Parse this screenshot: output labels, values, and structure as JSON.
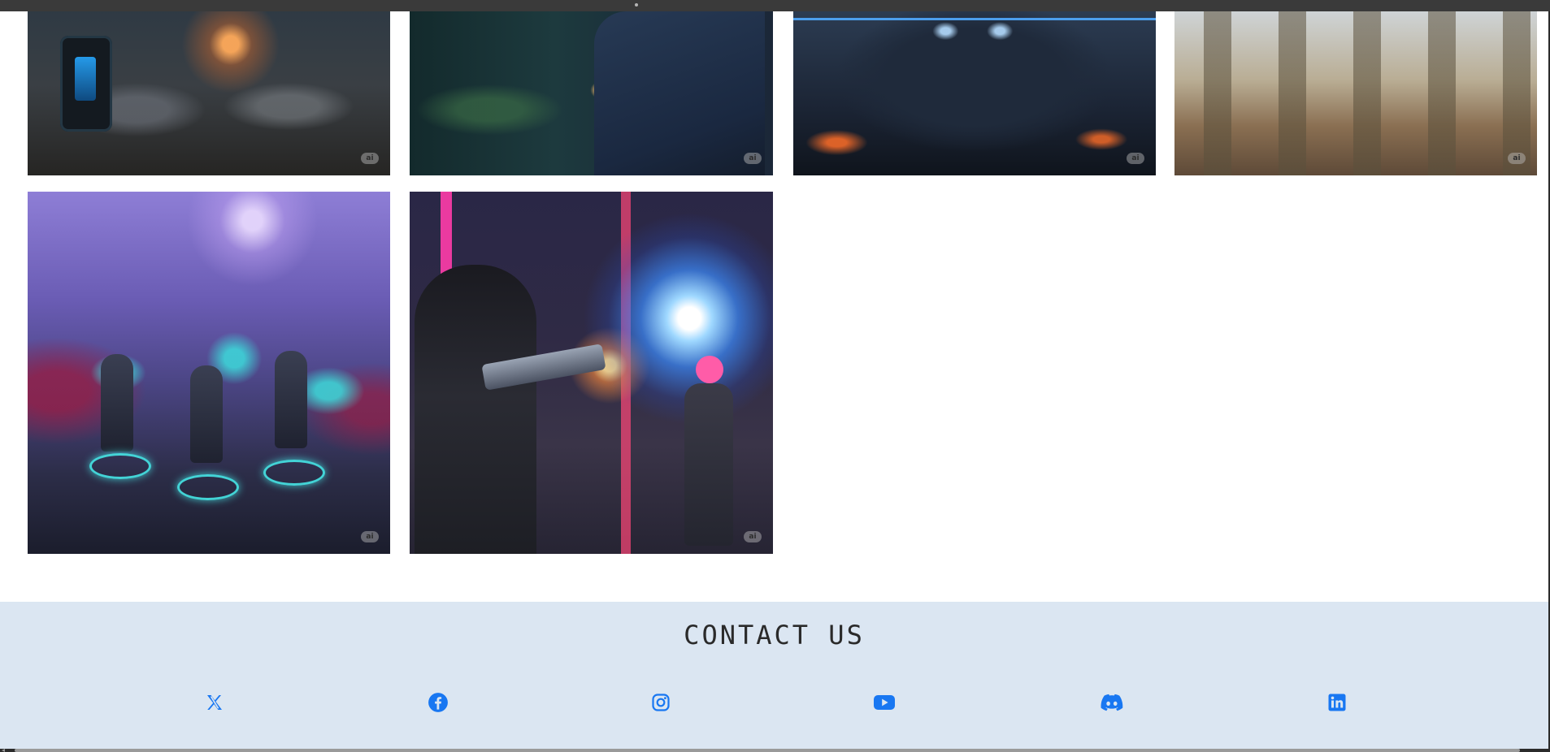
{
  "gallery": {
    "tiles": [
      {
        "id": "tile-1",
        "subject": "mechs-battle",
        "badge": "ai"
      },
      {
        "id": "tile-2",
        "subject": "alien-and-agent",
        "badge": "ai"
      },
      {
        "id": "tile-3",
        "subject": "hooded-glowing-eyes",
        "badge": "ai"
      },
      {
        "id": "tile-4",
        "subject": "soldiers-marching",
        "badge": "ai"
      },
      {
        "id": "tile-5",
        "subject": "alien-planet-squad",
        "badge": "ai"
      },
      {
        "id": "tile-6",
        "subject": "cyberpunk-firefight",
        "badge": "ai"
      }
    ]
  },
  "footer": {
    "title": "CONTACT US",
    "icon_color": "#1877f2",
    "background": "#dbe6f2",
    "social": [
      {
        "icon": "x-icon"
      },
      {
        "icon": "facebook-icon"
      },
      {
        "icon": "instagram-icon"
      },
      {
        "icon": "youtube-icon"
      },
      {
        "icon": "discord-icon"
      },
      {
        "icon": "linkedin-icon"
      }
    ]
  }
}
